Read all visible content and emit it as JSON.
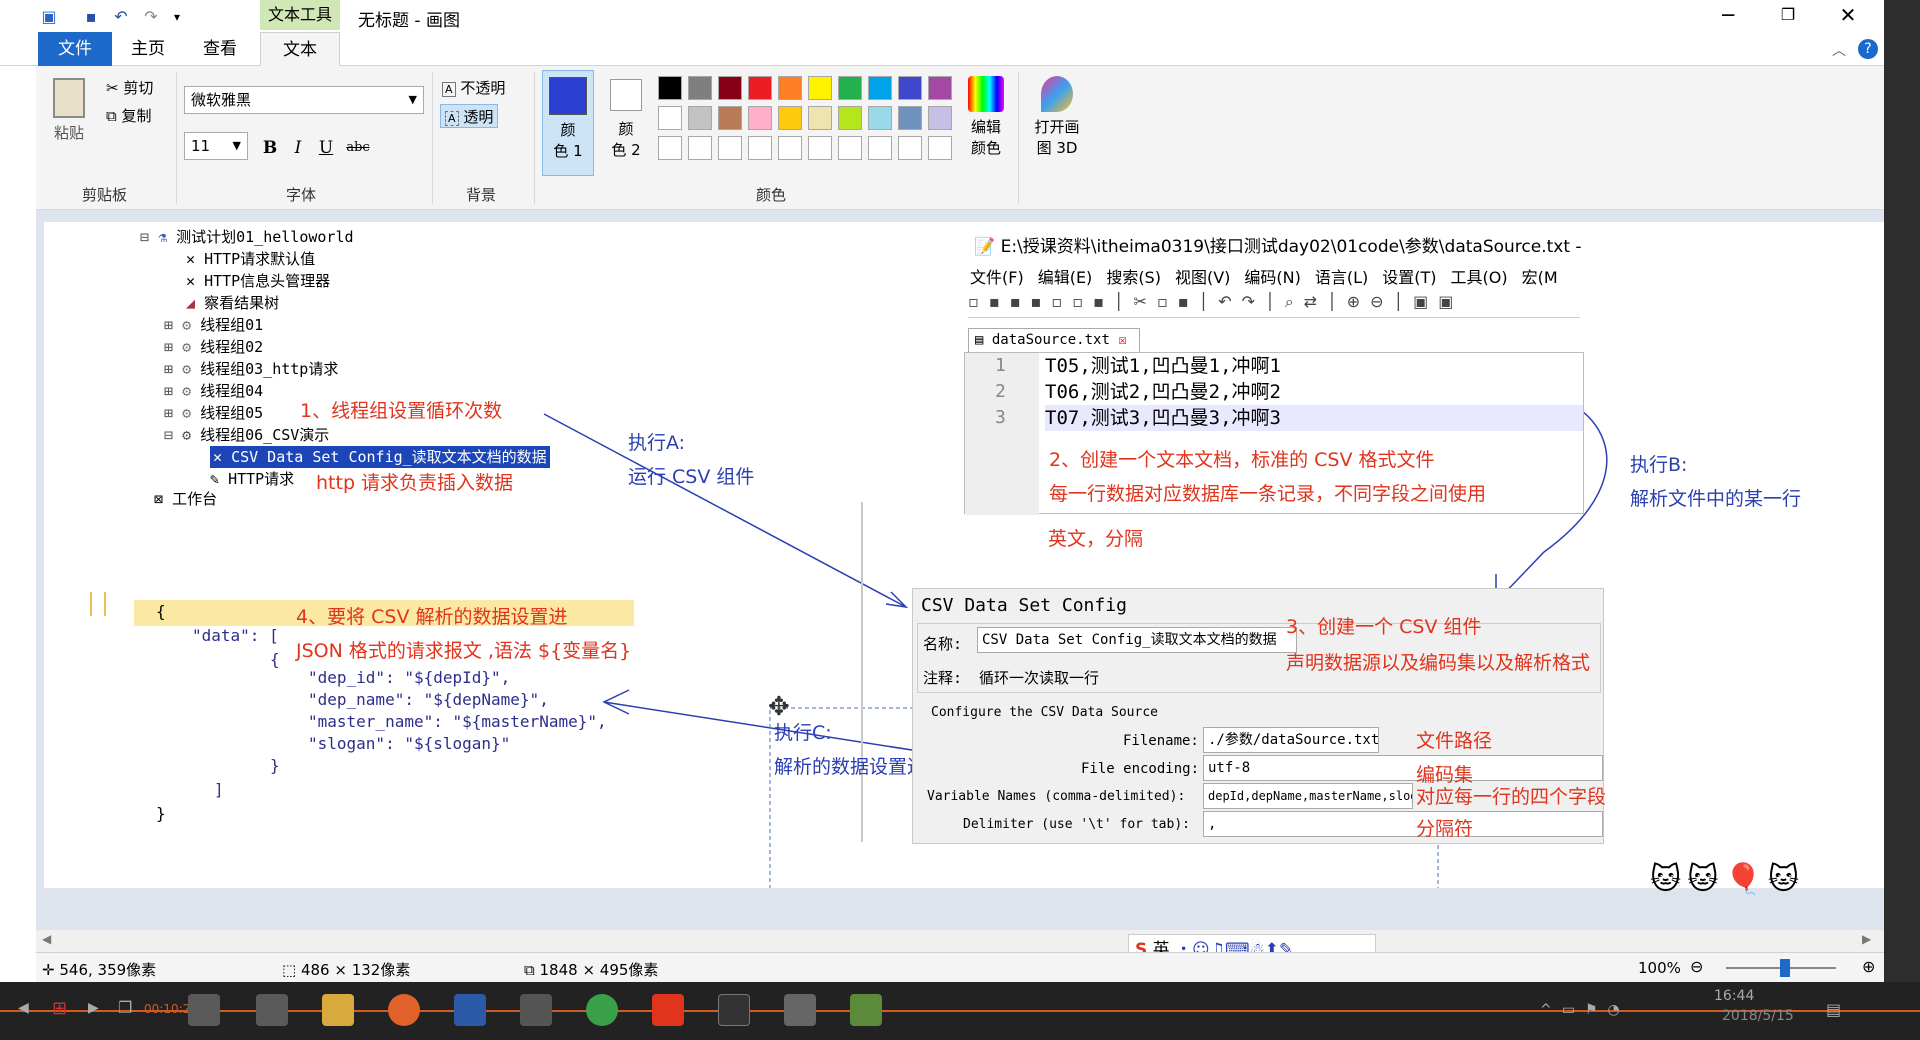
{
  "window": {
    "title": "无标题 - 画图",
    "context_tab_header": "文本工具",
    "min_icon": "minimize-icon",
    "max_icon": "maximize-icon",
    "close_icon": "close-icon"
  },
  "tabs": [
    "文件",
    "主页",
    "查看",
    "文本"
  ],
  "ribbon": {
    "clipboard": {
      "paste": "粘贴",
      "cut": "剪切",
      "copy": "复制",
      "label": "剪贴板"
    },
    "font": {
      "family": "微软雅黑",
      "size": "11",
      "bold": "B",
      "italic": "I",
      "underline": "U",
      "strike": "abc",
      "label": "字体"
    },
    "background": {
      "opaque": "不透明",
      "transparent": "透明",
      "label": "背景"
    },
    "colors": {
      "color1_line1": "颜",
      "color1_line2": "色 1",
      "color2_line1": "颜",
      "color2_line2": "色 2",
      "edit_line1": "编辑",
      "edit_line2": "颜色",
      "paint3d_line1": "打开画",
      "paint3d_line2": "图 3D",
      "label": "颜色",
      "color1_hex": "#2a3fd1",
      "color2_hex": "#ffffff",
      "palette_row1": [
        "#000000",
        "#7f7f7f",
        "#880015",
        "#ed1c24",
        "#ff7f27",
        "#fff200",
        "#22b14c",
        "#00a2e8",
        "#3f48cc",
        "#a349a4"
      ],
      "palette_row2": [
        "#ffffff",
        "#c3c3c3",
        "#b97a57",
        "#ffaec9",
        "#ffc90e",
        "#efe4b0",
        "#b5e61d",
        "#99d9ea",
        "#7092be",
        "#c8bfe7"
      ]
    }
  },
  "tree": {
    "root": "测试计划01_helloworld",
    "items": [
      "HTTP请求默认值",
      "HTTP信息头管理器",
      "察看结果树",
      "线程组01",
      "线程组02",
      "线程组03_http请求",
      "线程组04",
      "线程组05",
      "线程组06_CSV演示"
    ],
    "csv_item": "CSV Data Set Config_读取文本文档的数据",
    "http_item": "HTTP请求",
    "workbench": "工作台"
  },
  "annotations": {
    "a1": "1、线程组设置循环次数",
    "a_http": "http 请求负责插入数据",
    "exec_a_title": "执行A:",
    "exec_a_desc": "运行 CSV 组件",
    "a2_line1": "2、创建一个文本文档，标准的 CSV 格式文件",
    "a2_line2": "每一行数据对应数据库一条记录，不同字段之间使用",
    "a2_line3": "英文，分隔",
    "exec_b_title": "执行B:",
    "exec_b_desc": "解析文件中的某一行",
    "a3_line1": "3、创建一个 CSV 组件",
    "a3_line2": "声明数据源以及编码集以及解析格式",
    "a4_line1": "4、要将 CSV 解析的数据设置进",
    "a4_line2": "JSON 格式的请求报文 ,语法 ${变量名}",
    "exec_c_title": "执行C:",
    "exec_c_desc": "解析的数据设置进 JSON",
    "f_path": "文件路径",
    "f_enc": "编码集",
    "f_vars": "对应每一行的四个字段",
    "f_delim": "分隔符"
  },
  "notepad": {
    "title": "E:\\授课资料\\itheima0319\\接口测试day02\\01code\\参数\\dataSource.txt - Not",
    "menu": [
      "文件(F)",
      "编辑(E)",
      "搜索(S)",
      "视图(V)",
      "编码(N)",
      "语言(L)",
      "设置(T)",
      "工具(O)",
      "宏(M"
    ],
    "tab": "dataSource.txt",
    "lines": [
      "T05,测试1,凹凸曼1,冲啊1",
      "T06,测试2,凹凸曼2,冲啊2",
      "T07,测试3,凹凸曼3,冲啊3"
    ],
    "line_numbers": [
      "1",
      "2",
      "3"
    ]
  },
  "csv_config": {
    "title": "CSV Data Set Config",
    "name_label": "名称:",
    "name_value": "CSV Data Set Config_读取文本文档的数据",
    "comment_label": "注释:",
    "comment_value": "循环一次读取一行",
    "section": "Configure the CSV Data Source",
    "filename_label": "Filename:",
    "filename_value": "./参数/dataSource.txt",
    "encoding_label": "File encoding:",
    "encoding_value": "utf-8",
    "varnames_label": "Variable Names (comma-delimited):",
    "varnames_value": "depId,depName,masterName,slogan",
    "delimiter_label": "Delimiter (use '\\t' for tab):",
    "delimiter_value": ","
  },
  "json_body": {
    "open": "{",
    "data_key": "\"data\": [",
    "obj_open": "{",
    "l1": "\"dep_id\": \"${depId}\",",
    "l2": "\"dep_name\": \"${depName}\",",
    "l3": "\"master_name\": \"${masterName}\",",
    "l4": "\"slogan\": \"${slogan}\"",
    "obj_close": "}",
    "arr_close": "]",
    "close": "}"
  },
  "status": {
    "cursor": "546, 359像素",
    "selection": "486 × 132像素",
    "size": "1848 × 495像素",
    "zoom": "100%"
  },
  "ime": {
    "lang": "英"
  },
  "taskbar": {
    "time": "16:44",
    "date": "2018/5/15",
    "recording": "00:10:26"
  }
}
